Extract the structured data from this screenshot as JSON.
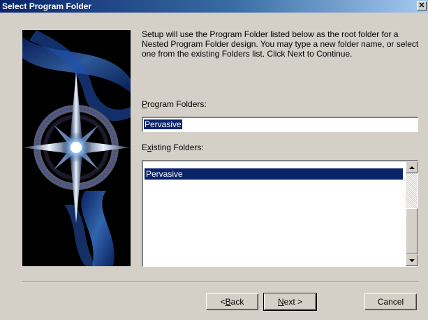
{
  "window": {
    "title": "Select Program Folder"
  },
  "description": "Setup will use the Program Folder listed below as the root folder for a Nested Program Folder design. You may type a new folder name, or select one from the existing Folders list. Click Next to Continue.",
  "program_folders": {
    "label_accel": "P",
    "label_rest": "rogram Folders:",
    "value": "Pervasive"
  },
  "existing_folders": {
    "label_pre": "E",
    "label_accel": "x",
    "label_rest": "isting Folders:",
    "items": [
      "Pervasive"
    ],
    "selected": "Pervasive"
  },
  "buttons": {
    "back_pre": "< ",
    "back_accel": "B",
    "back_rest": "ack",
    "next_accel": "N",
    "next_rest": "ext >",
    "cancel": "Cancel"
  },
  "icons": {
    "close": "close-icon",
    "scroll_up": "scroll-up-arrow-icon",
    "scroll_down": "scroll-down-arrow-icon"
  },
  "colors": {
    "title_start": "#0a246a",
    "title_end": "#a6caf0",
    "selection": "#0a246a",
    "face": "#d4d0c8"
  }
}
